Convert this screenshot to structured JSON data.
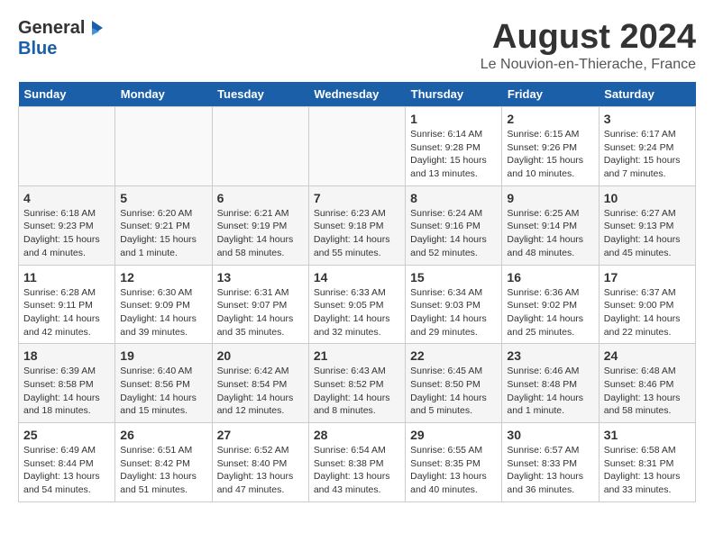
{
  "header": {
    "logo_line1": "General",
    "logo_line2": "Blue",
    "month_title": "August 2024",
    "location": "Le Nouvion-en-Thierache, France"
  },
  "weekdays": [
    "Sunday",
    "Monday",
    "Tuesday",
    "Wednesday",
    "Thursday",
    "Friday",
    "Saturday"
  ],
  "weeks": [
    [
      {
        "day": "",
        "info": ""
      },
      {
        "day": "",
        "info": ""
      },
      {
        "day": "",
        "info": ""
      },
      {
        "day": "",
        "info": ""
      },
      {
        "day": "1",
        "info": "Sunrise: 6:14 AM\nSunset: 9:28 PM\nDaylight: 15 hours\nand 13 minutes."
      },
      {
        "day": "2",
        "info": "Sunrise: 6:15 AM\nSunset: 9:26 PM\nDaylight: 15 hours\nand 10 minutes."
      },
      {
        "day": "3",
        "info": "Sunrise: 6:17 AM\nSunset: 9:24 PM\nDaylight: 15 hours\nand 7 minutes."
      }
    ],
    [
      {
        "day": "4",
        "info": "Sunrise: 6:18 AM\nSunset: 9:23 PM\nDaylight: 15 hours\nand 4 minutes."
      },
      {
        "day": "5",
        "info": "Sunrise: 6:20 AM\nSunset: 9:21 PM\nDaylight: 15 hours\nand 1 minute."
      },
      {
        "day": "6",
        "info": "Sunrise: 6:21 AM\nSunset: 9:19 PM\nDaylight: 14 hours\nand 58 minutes."
      },
      {
        "day": "7",
        "info": "Sunrise: 6:23 AM\nSunset: 9:18 PM\nDaylight: 14 hours\nand 55 minutes."
      },
      {
        "day": "8",
        "info": "Sunrise: 6:24 AM\nSunset: 9:16 PM\nDaylight: 14 hours\nand 52 minutes."
      },
      {
        "day": "9",
        "info": "Sunrise: 6:25 AM\nSunset: 9:14 PM\nDaylight: 14 hours\nand 48 minutes."
      },
      {
        "day": "10",
        "info": "Sunrise: 6:27 AM\nSunset: 9:13 PM\nDaylight: 14 hours\nand 45 minutes."
      }
    ],
    [
      {
        "day": "11",
        "info": "Sunrise: 6:28 AM\nSunset: 9:11 PM\nDaylight: 14 hours\nand 42 minutes."
      },
      {
        "day": "12",
        "info": "Sunrise: 6:30 AM\nSunset: 9:09 PM\nDaylight: 14 hours\nand 39 minutes."
      },
      {
        "day": "13",
        "info": "Sunrise: 6:31 AM\nSunset: 9:07 PM\nDaylight: 14 hours\nand 35 minutes."
      },
      {
        "day": "14",
        "info": "Sunrise: 6:33 AM\nSunset: 9:05 PM\nDaylight: 14 hours\nand 32 minutes."
      },
      {
        "day": "15",
        "info": "Sunrise: 6:34 AM\nSunset: 9:03 PM\nDaylight: 14 hours\nand 29 minutes."
      },
      {
        "day": "16",
        "info": "Sunrise: 6:36 AM\nSunset: 9:02 PM\nDaylight: 14 hours\nand 25 minutes."
      },
      {
        "day": "17",
        "info": "Sunrise: 6:37 AM\nSunset: 9:00 PM\nDaylight: 14 hours\nand 22 minutes."
      }
    ],
    [
      {
        "day": "18",
        "info": "Sunrise: 6:39 AM\nSunset: 8:58 PM\nDaylight: 14 hours\nand 18 minutes."
      },
      {
        "day": "19",
        "info": "Sunrise: 6:40 AM\nSunset: 8:56 PM\nDaylight: 14 hours\nand 15 minutes."
      },
      {
        "day": "20",
        "info": "Sunrise: 6:42 AM\nSunset: 8:54 PM\nDaylight: 14 hours\nand 12 minutes."
      },
      {
        "day": "21",
        "info": "Sunrise: 6:43 AM\nSunset: 8:52 PM\nDaylight: 14 hours\nand 8 minutes."
      },
      {
        "day": "22",
        "info": "Sunrise: 6:45 AM\nSunset: 8:50 PM\nDaylight: 14 hours\nand 5 minutes."
      },
      {
        "day": "23",
        "info": "Sunrise: 6:46 AM\nSunset: 8:48 PM\nDaylight: 14 hours\nand 1 minute."
      },
      {
        "day": "24",
        "info": "Sunrise: 6:48 AM\nSunset: 8:46 PM\nDaylight: 13 hours\nand 58 minutes."
      }
    ],
    [
      {
        "day": "25",
        "info": "Sunrise: 6:49 AM\nSunset: 8:44 PM\nDaylight: 13 hours\nand 54 minutes."
      },
      {
        "day": "26",
        "info": "Sunrise: 6:51 AM\nSunset: 8:42 PM\nDaylight: 13 hours\nand 51 minutes."
      },
      {
        "day": "27",
        "info": "Sunrise: 6:52 AM\nSunset: 8:40 PM\nDaylight: 13 hours\nand 47 minutes."
      },
      {
        "day": "28",
        "info": "Sunrise: 6:54 AM\nSunset: 8:38 PM\nDaylight: 13 hours\nand 43 minutes."
      },
      {
        "day": "29",
        "info": "Sunrise: 6:55 AM\nSunset: 8:35 PM\nDaylight: 13 hours\nand 40 minutes."
      },
      {
        "day": "30",
        "info": "Sunrise: 6:57 AM\nSunset: 8:33 PM\nDaylight: 13 hours\nand 36 minutes."
      },
      {
        "day": "31",
        "info": "Sunrise: 6:58 AM\nSunset: 8:31 PM\nDaylight: 13 hours\nand 33 minutes."
      }
    ]
  ]
}
